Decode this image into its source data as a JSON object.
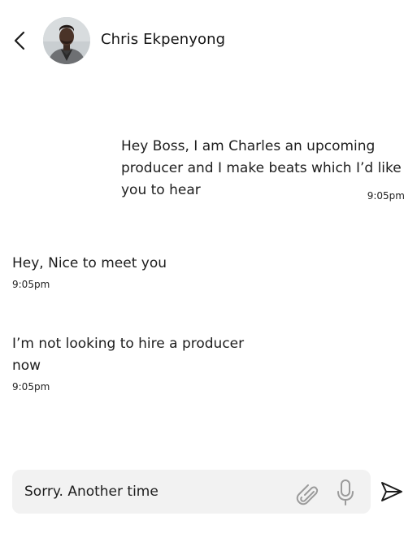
{
  "header": {
    "contact_name": "Chris Ekpenyong",
    "back_icon": "chevron-left-icon",
    "avatar_icon": "avatar-photo"
  },
  "messages": [
    {
      "direction": "outgoing",
      "text": "Hey Boss, I am Charles an upcoming producer and I make beats which I’d like you to hear",
      "time": "9:05pm"
    },
    {
      "direction": "incoming",
      "text": "Hey, Nice to meet you",
      "time": "9:05pm"
    },
    {
      "direction": "incoming",
      "text": "I’m not looking to hire a producer now",
      "time": "9:05pm"
    }
  ],
  "composer": {
    "value": "Sorry. Another time",
    "attach_icon": "paperclip-icon",
    "mic_icon": "microphone-icon",
    "send_icon": "send-icon"
  }
}
